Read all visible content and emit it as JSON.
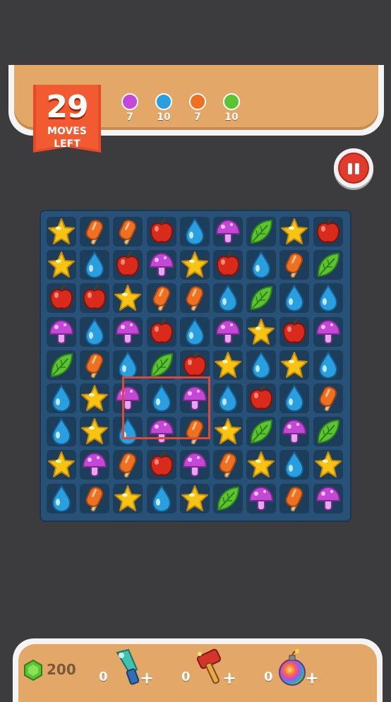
{
  "moves": {
    "count": "29",
    "label_line1": "MOVES",
    "label_line2": "LEFT"
  },
  "goals": [
    {
      "piece": "mushroom",
      "color": "#c447d8",
      "count": "7"
    },
    {
      "piece": "drop",
      "color": "#2a9fe0",
      "count": "10"
    },
    {
      "piece": "popsicle",
      "color": "#f07022",
      "count": "7"
    },
    {
      "piece": "leaf",
      "color": "#5ac431",
      "count": "10"
    }
  ],
  "pause": {
    "icon": "pause-icon"
  },
  "board": {
    "rows": 9,
    "cols": 9,
    "grid": [
      [
        "star",
        "popsicle",
        "popsicle",
        "apple",
        "drop",
        "mushroom",
        "leaf",
        "star",
        "apple"
      ],
      [
        "star",
        "drop",
        "apple",
        "mushroom",
        "star",
        "apple",
        "drop",
        "popsicle",
        "leaf"
      ],
      [
        "apple",
        "apple",
        "star",
        "popsicle",
        "popsicle",
        "drop",
        "leaf",
        "drop",
        "drop"
      ],
      [
        "mushroom",
        "drop",
        "mushroom",
        "apple",
        "drop",
        "mushroom",
        "star",
        "apple",
        "mushroom"
      ],
      [
        "leaf",
        "popsicle",
        "drop",
        "leaf",
        "apple",
        "star",
        "drop",
        "star",
        "drop"
      ],
      [
        "drop",
        "star",
        "mushroom",
        "drop",
        "mushroom",
        "drop",
        "apple",
        "drop",
        "popsicle"
      ],
      [
        "drop",
        "star",
        "drop",
        "mushroom",
        "popsicle",
        "star",
        "leaf",
        "mushroom",
        "leaf"
      ],
      [
        "star",
        "mushroom",
        "popsicle",
        "apple",
        "mushroom",
        "popsicle",
        "star",
        "drop",
        "star"
      ],
      [
        "drop",
        "popsicle",
        "star",
        "drop",
        "star",
        "leaf",
        "mushroom",
        "popsicle",
        "mushroom"
      ]
    ],
    "highlight": {
      "rows": [
        5,
        6
      ],
      "cols": [
        2,
        4
      ],
      "color": "#e2453a"
    }
  },
  "colors": {
    "star": "#f7c414",
    "popsicle": "#f07022",
    "apple": "#d92a1c",
    "drop": "#2a9fe0",
    "mushroom": "#c447d8",
    "leaf": "#5ac431"
  },
  "footer": {
    "gems": "200",
    "gem_icon": "green-gem-icon",
    "boosters": [
      {
        "name": "blaster",
        "icon": "ray-gun-icon",
        "count": "0"
      },
      {
        "name": "hammer",
        "icon": "hammer-icon",
        "count": "0"
      },
      {
        "name": "bomb",
        "icon": "rainbow-bomb-icon",
        "count": "0"
      }
    ]
  }
}
